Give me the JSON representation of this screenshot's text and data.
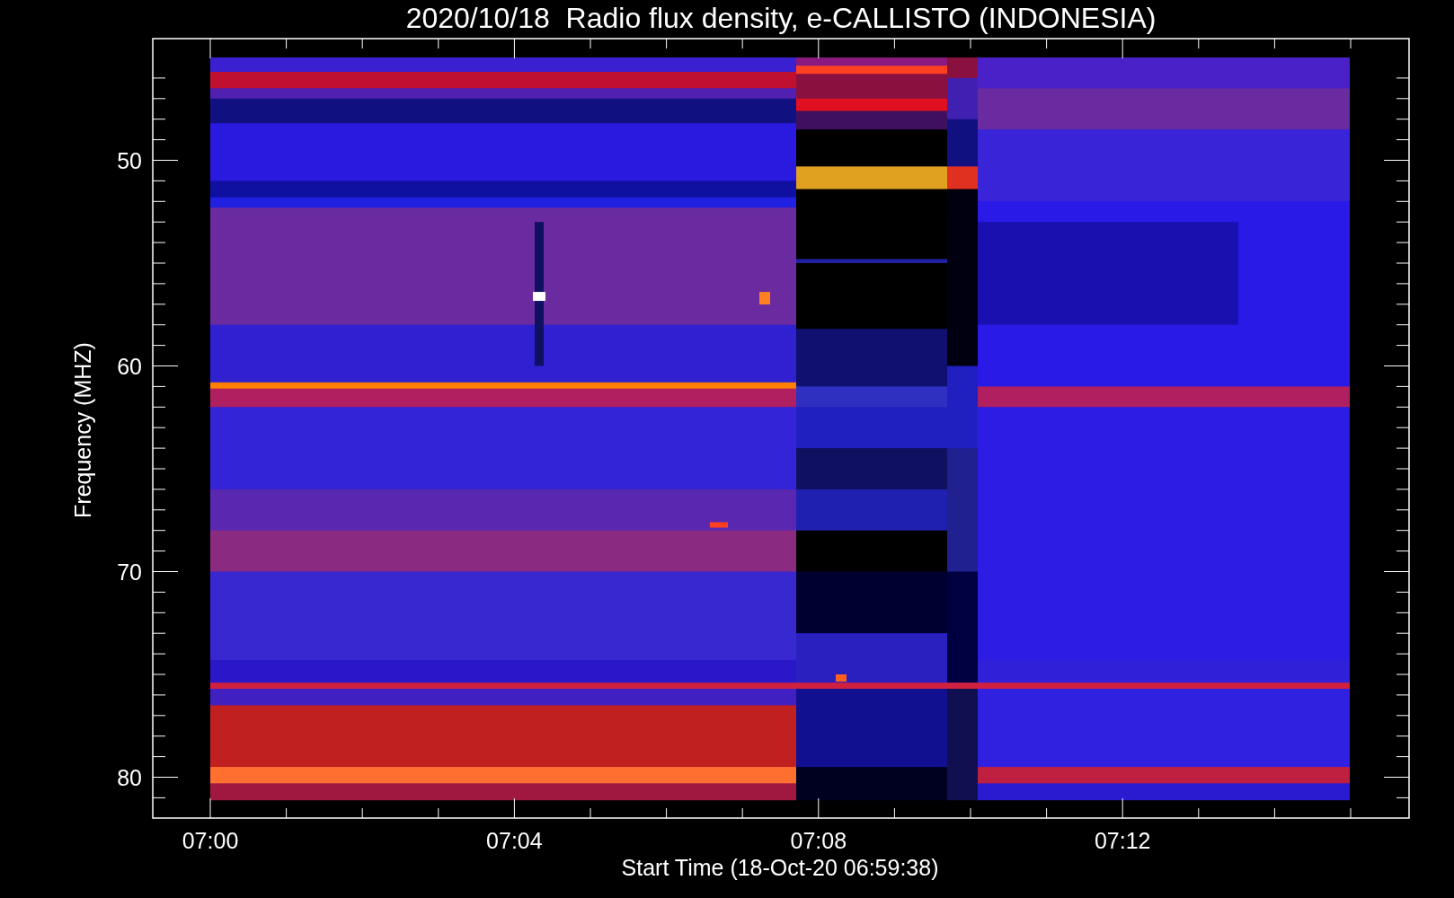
{
  "title": "2020/10/18  Radio flux density, e-CALLISTO (INDONESIA)",
  "y_axis": {
    "label": "Frequency (MHZ)",
    "ticks": [
      "50",
      "60",
      "70",
      "80"
    ]
  },
  "x_axis": {
    "label": "Start Time (18-Oct-20 06:59:38)",
    "ticks": [
      "07:00",
      "07:04",
      "07:08",
      "07:12"
    ]
  }
}
